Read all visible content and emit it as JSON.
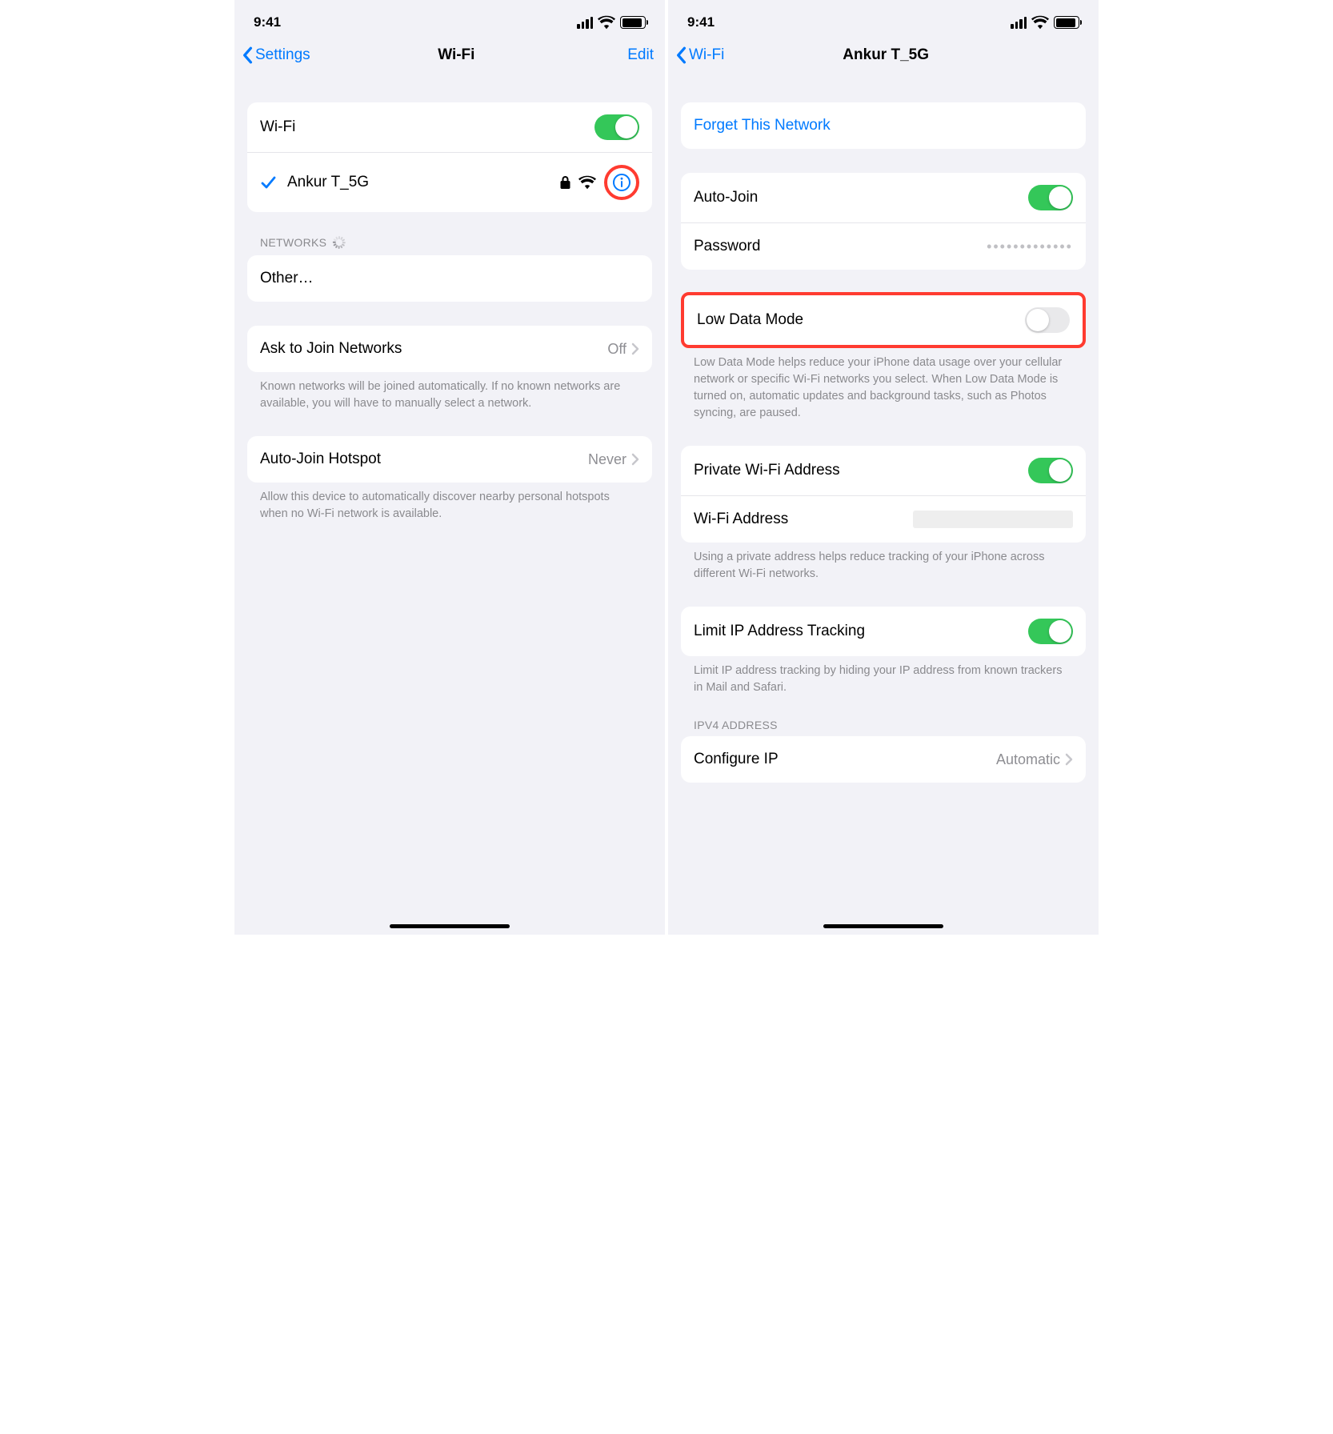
{
  "status": {
    "time": "9:41"
  },
  "left": {
    "back_label": "Settings",
    "title": "Wi-Fi",
    "edit_label": "Edit",
    "wifi_label": "Wi-Fi",
    "network_name": "Ankur T_5G",
    "networks_header": "NETWORKS",
    "other_label": "Other…",
    "ask_label": "Ask to Join Networks",
    "ask_value": "Off",
    "ask_footer": "Known networks will be joined automatically. If no known networks are available, you will have to manually select a network.",
    "hotspot_label": "Auto-Join Hotspot",
    "hotspot_value": "Never",
    "hotspot_footer": "Allow this device to automatically discover nearby personal hotspots when no Wi-Fi network is available."
  },
  "right": {
    "back_label": "Wi-Fi",
    "title": "Ankur T_5G",
    "forget_label": "Forget This Network",
    "autojoin_label": "Auto-Join",
    "password_label": "Password",
    "password_value": "•••••••••••••",
    "ldm_label": "Low Data Mode",
    "ldm_footer": "Low Data Mode helps reduce your iPhone data usage over your cellular network or specific Wi-Fi networks you select. When Low Data Mode is turned on, automatic updates and background tasks, such as Photos syncing, are paused.",
    "private_label": "Private Wi-Fi Address",
    "wifiaddr_label": "Wi-Fi Address",
    "private_footer": "Using a private address helps reduce tracking of your iPhone across different Wi-Fi networks.",
    "limitip_label": "Limit IP Address Tracking",
    "limitip_footer": "Limit IP address tracking by hiding your IP address from known trackers in Mail and Safari.",
    "ipv4_header": "IPV4 ADDRESS",
    "configip_label": "Configure IP",
    "configip_value": "Automatic"
  }
}
